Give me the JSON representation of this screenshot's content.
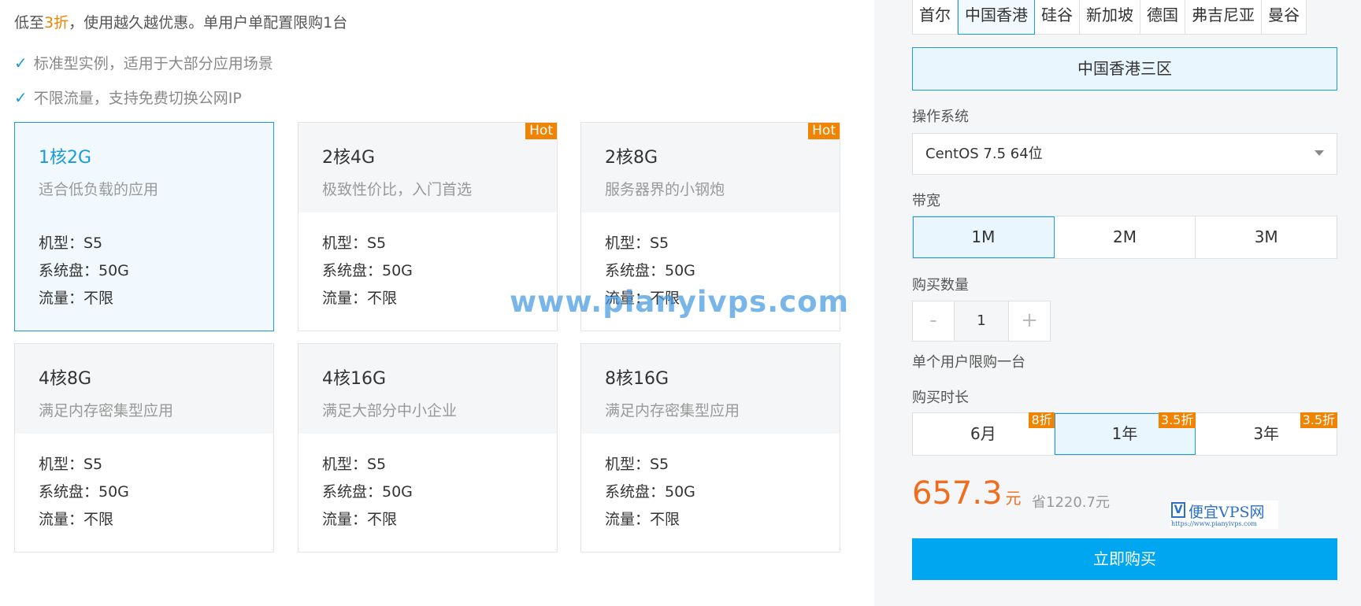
{
  "promo": {
    "prefix": "低至",
    "highlight": "3折",
    "suffix": "，使用越久越优惠。单用户单配置限购1台"
  },
  "features": [
    "标准型实例，适用于大部分应用场景",
    "不限流量，支持免费切换公网IP"
  ],
  "plans": [
    {
      "name": "1核2G",
      "desc": "适合低负载的应用",
      "model": "机型：S5",
      "disk": "系统盘：50G",
      "traffic": "流量：不限",
      "badge": ""
    },
    {
      "name": "2核4G",
      "desc": "极致性价比，入门首选",
      "model": "机型：S5",
      "disk": "系统盘：50G",
      "traffic": "流量：不限",
      "badge": "Hot"
    },
    {
      "name": "2核8G",
      "desc": "服务器界的小钢炮",
      "model": "机型：S5",
      "disk": "系统盘：50G",
      "traffic": "流量：不限",
      "badge": "Hot"
    },
    {
      "name": "4核8G",
      "desc": "满足内存密集型应用",
      "model": "机型：S5",
      "disk": "系统盘：50G",
      "traffic": "流量：不限",
      "badge": ""
    },
    {
      "name": "4核16G",
      "desc": "满足大部分中小企业",
      "model": "机型：S5",
      "disk": "系统盘：50G",
      "traffic": "流量：不限",
      "badge": ""
    },
    {
      "name": "8核16G",
      "desc": "满足内存密集型应用",
      "model": "机型：S5",
      "disk": "系统盘：50G",
      "traffic": "流量：不限",
      "badge": ""
    }
  ],
  "watermark": "www.pianyivps.com",
  "regions": [
    "首尔",
    "中国香港",
    "硅谷",
    "新加坡",
    "德国",
    "弗吉尼亚",
    "曼谷"
  ],
  "zone": "中国香港三区",
  "os": {
    "label": "操作系统",
    "value": "CentOS 7.5 64位"
  },
  "bandwidth": {
    "label": "带宽",
    "options": [
      "1M",
      "2M",
      "3M"
    ]
  },
  "quantity": {
    "label": "购买数量",
    "minus": "-",
    "value": "1",
    "plus": "+",
    "limit_note": "单个用户限购一台"
  },
  "duration": {
    "label": "购买时长",
    "options": [
      {
        "label": "6月",
        "badge": "8折"
      },
      {
        "label": "1年",
        "badge": "3.5折"
      },
      {
        "label": "3年",
        "badge": "3.5折"
      }
    ]
  },
  "price": {
    "amount": "657.3",
    "unit": "元",
    "saving": "省1220.7元"
  },
  "logo": {
    "mark": "V",
    "brand": "便宜VPS网",
    "url": "https://www.pianyivps.com"
  },
  "buy_label": "立即购买",
  "colors": {
    "accent": "#1a9bdc",
    "highlight": "#f08300",
    "price": "#f06c1e",
    "buy_button": "#00a6f0"
  }
}
